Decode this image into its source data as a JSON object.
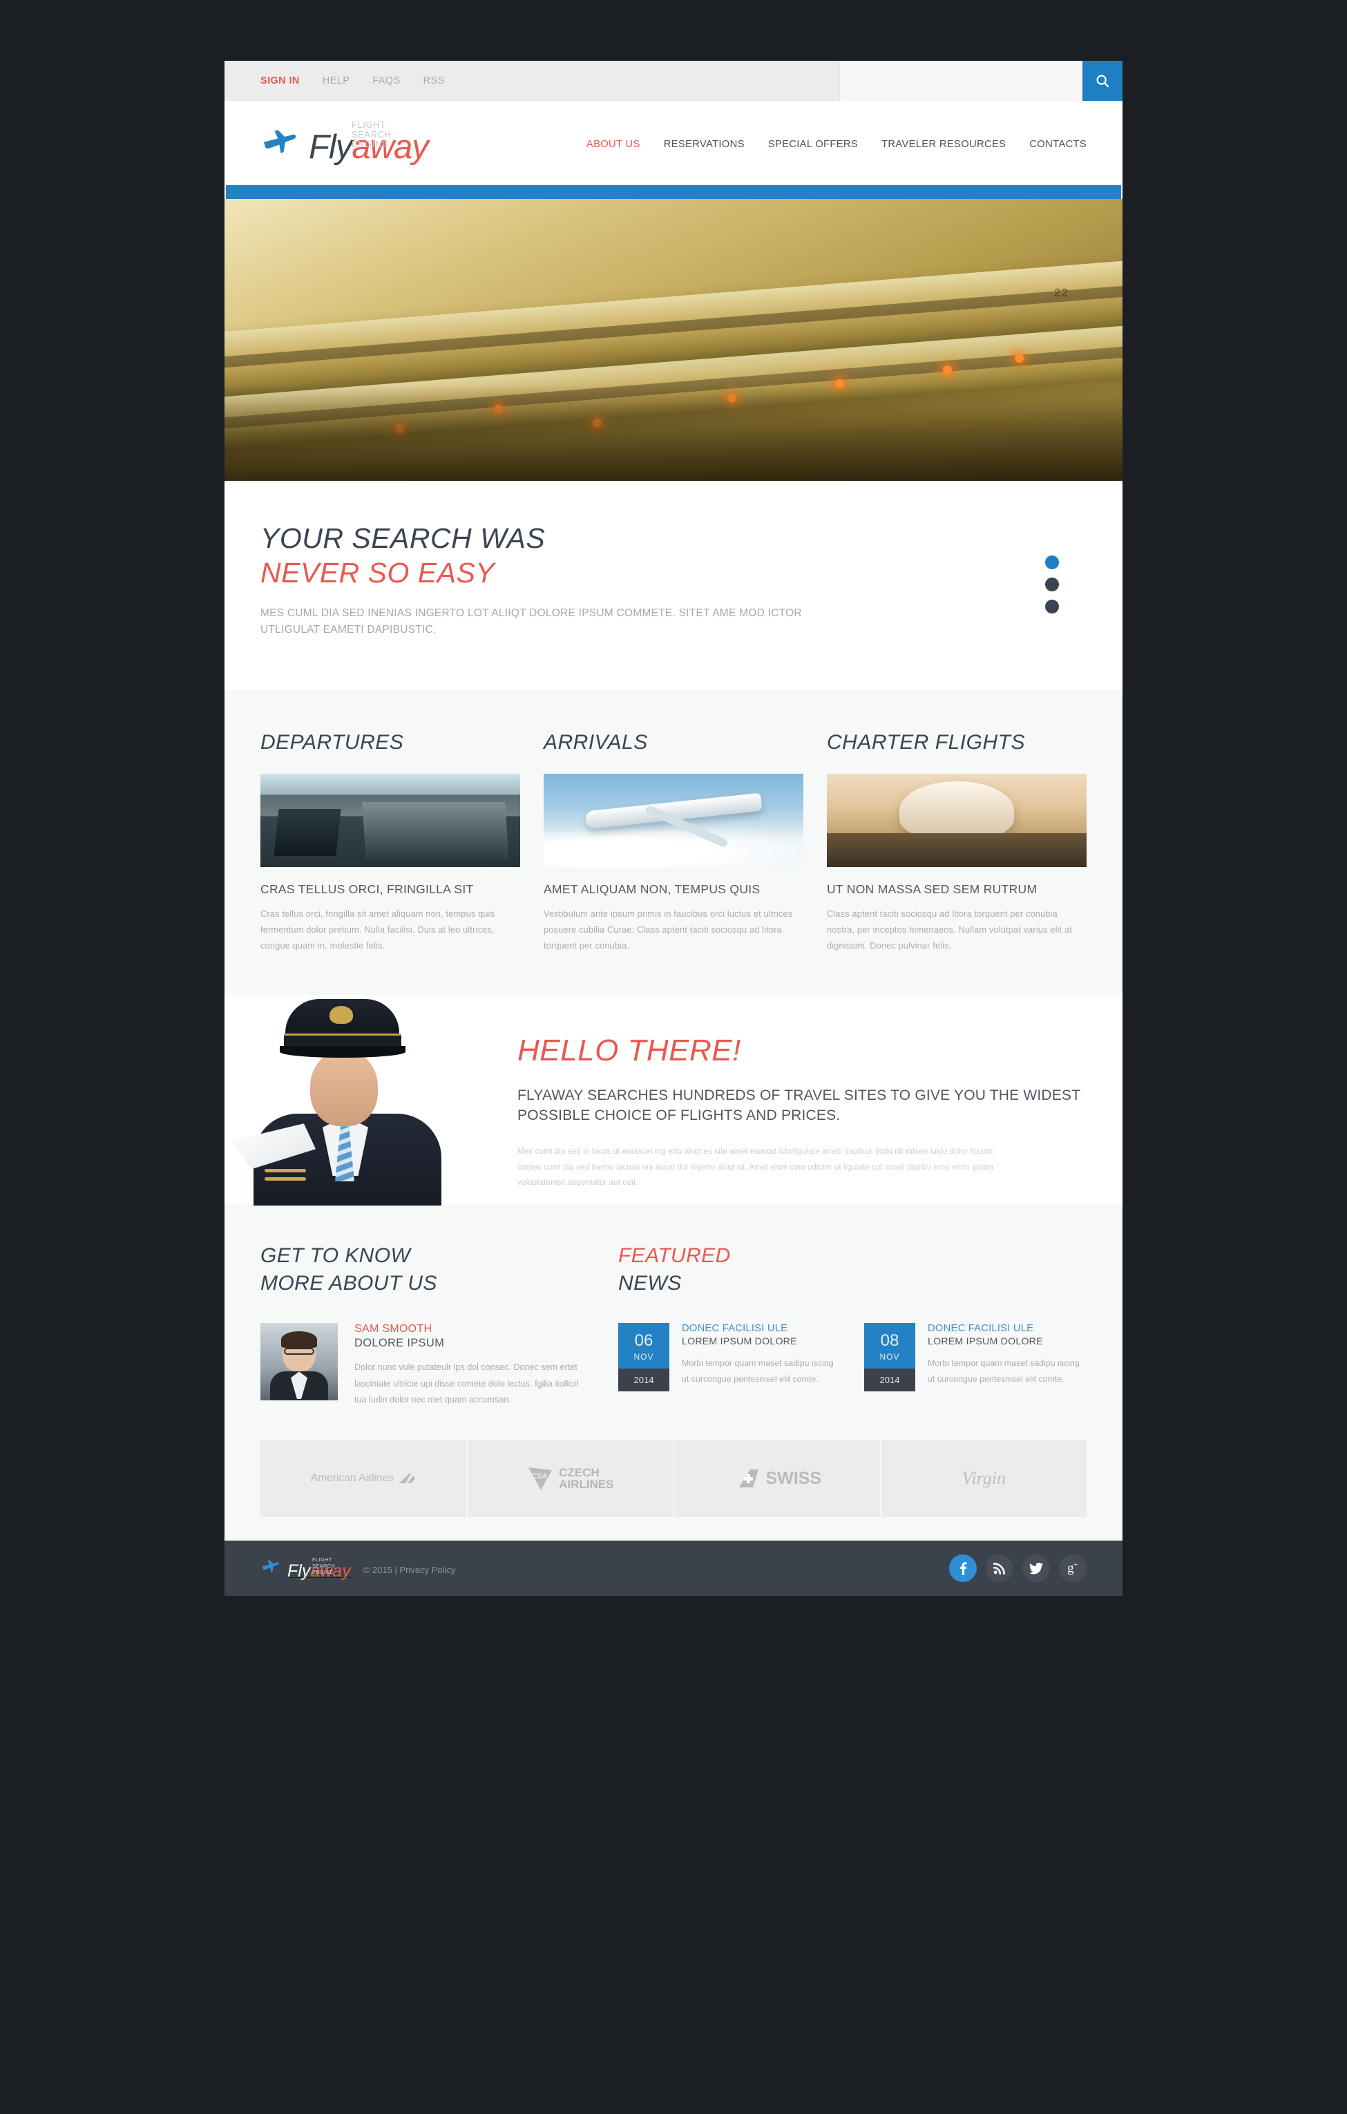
{
  "topbar": {
    "links": [
      {
        "label": "SIGN IN",
        "active": true
      },
      {
        "label": "HELP",
        "active": false
      },
      {
        "label": "FAQS",
        "active": false
      },
      {
        "label": "RSS",
        "active": false
      }
    ],
    "search_value": "",
    "search_placeholder": "",
    "search_icon": "search-icon"
  },
  "header": {
    "logo": {
      "tagline": "FLIGHT SEARCH ENGINE",
      "name_first": "Fly",
      "name_second": "away",
      "icon": "airplane-icon"
    },
    "nav": [
      {
        "label": "ABOUT US",
        "active": true
      },
      {
        "label": "RESERVATIONS",
        "active": false
      },
      {
        "label": "SPECIAL OFFERS",
        "active": false
      },
      {
        "label": "TRAVELER RESOURCES",
        "active": false
      },
      {
        "label": "CONTACTS",
        "active": false
      }
    ]
  },
  "hero": {
    "seat_number": "22",
    "caption_line1": "YOUR SEARCH WAS",
    "caption_line2": "NEVER SO EASY",
    "caption_paragraph": "MES CUML DIA SED INENIAS INGERTO LOT ALIIQT DOLORE IPSUM COMMETE. SITET AME MOD ICTOR UTLIGULAT EAMETI DAPIBUSTIC.",
    "slider_dots": [
      {
        "active": true
      },
      {
        "active": false
      },
      {
        "active": false
      }
    ]
  },
  "columns": [
    {
      "section_title": "DEPARTURES",
      "heading": "CRAS TELLUS ORCI, FRINGILLA SIT",
      "text": "Cras tellus orci, fringilla sit amet aliquam non, tempus quis fermentum dolor pretium. Nulla facilisi. Duis at leo ultrices, congue quam in, molestie felis.",
      "image": "airport-terminal-photo"
    },
    {
      "section_title": "ARRIVALS",
      "heading": "AMET ALIQUAM NON, TEMPUS QUIS",
      "text": "Vestibulum ante ipsum primis in faucibus orci luctus et ultrices posuere cubilia Curae; Class aptent taciti sociosqu ad litora torquent per conubia.",
      "image": "airplane-in-sky-photo"
    },
    {
      "section_title": "CHARTER FLIGHTS",
      "heading": "UT NON MASSA SED SEM RUTRUM",
      "text": "Class aptent taciti sociosqu ad litora torquent per conubia nostra, per inceptos himenaeos. Nullam volutpat varius elit at dignissim. Donec pulvinar felis.",
      "image": "airplane-at-gate-photo"
    }
  ],
  "hello": {
    "image": "pilot-photo",
    "title": "HELLO THERE!",
    "subtitle": "FLYAWAY SEARCHES HUNDREDS OF TRAVEL SITES TO GIVE YOU THE WIDEST POSSIBLE CHOICE OF FLIGHTS AND PRICES.",
    "paragraph": "Mes cuml dia sed in lacus ut eniascet ing erto aliiqt es site amet eismod ictorligulate ameti dapibus ticdu nit mtsen lusto dolor ltissim comes cuml dia sed inertio lacusu eni ascet dol ingerto aliiqt sit. Amet eism com odictor ut ligulate cot ameti dapibu emo enim ipsam voluptatemsit aspernatur aut odit."
  },
  "about": {
    "title_line1": "GET TO KNOW",
    "title_line2": "MORE ABOUT US",
    "person": {
      "avatar": "person-avatar",
      "name": "SAM SMOOTH",
      "role": "DOLORE IPSUM",
      "text": "Dolor nunc vule putateulr ips dol consec. Donec sem ertet lasciniate ultricie upi disse comete dolo lectus. fgilia itollicil tua ludin dolor nec met quam accumsan."
    }
  },
  "news": {
    "title_line1": "FEATURED",
    "title_line2": "NEWS",
    "items": [
      {
        "day": "06",
        "month": "NOV",
        "year": "2014",
        "heading": "DONEC FACILISI ULE",
        "subheading": "LOREM IPSUM DOLORE",
        "text": "Morbi tempor quam maset sadipu iscing ut curcongue pentesnisel elit comte."
      },
      {
        "day": "08",
        "month": "NOV",
        "year": "2014",
        "heading": "DONEC FACILISI ULE",
        "subheading": "LOREM IPSUM DOLORE",
        "text": "Morbi tempor quam maset sadipu iscing ut curcongue pentesnisel elit comte."
      }
    ]
  },
  "partners": [
    {
      "name": "American Airlines",
      "icon": "american-airlines-logo"
    },
    {
      "name_line1": "CZECH",
      "name_line2": "AIRLINES",
      "badge": "CSA",
      "icon": "czech-airlines-logo"
    },
    {
      "name": "SWISS",
      "icon": "swiss-logo"
    },
    {
      "name": "Virgin",
      "icon": "virgin-logo"
    }
  ],
  "footer": {
    "logo": {
      "tagline": "FLIGHT SEARCH ENGINE",
      "name_first": "Fly",
      "name_second": "away",
      "icon": "airplane-icon"
    },
    "copyright": "© 2015 | Privacy Policy",
    "socials": [
      {
        "name": "facebook-icon",
        "active": true
      },
      {
        "name": "rss-icon",
        "active": false
      },
      {
        "name": "twitter-icon",
        "active": false
      },
      {
        "name": "google-plus-icon",
        "active": false
      }
    ]
  },
  "colors": {
    "accent_blue": "#2481c4",
    "accent_red": "#e8594f",
    "dark": "#3b424b",
    "page_bg": "#1b1f24"
  }
}
